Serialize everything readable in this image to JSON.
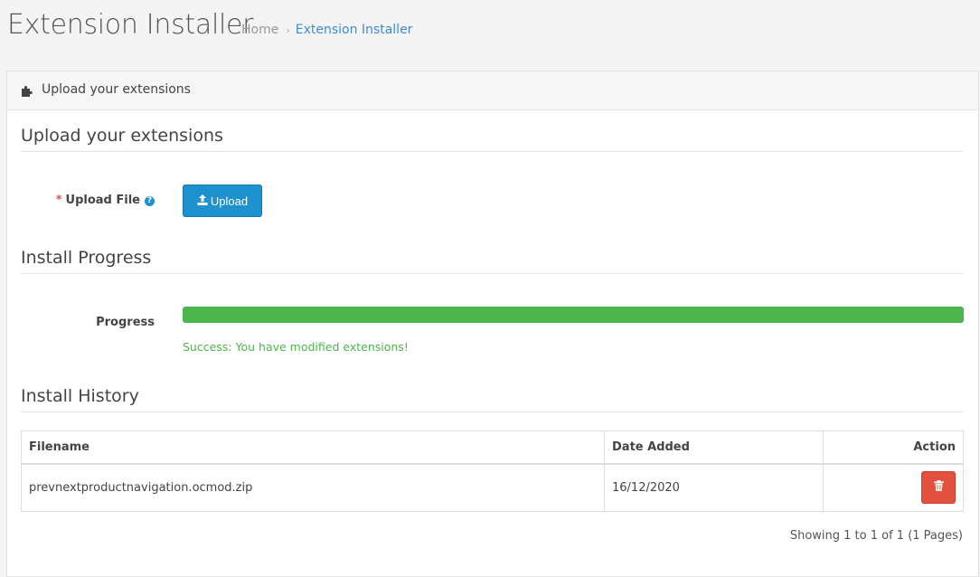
{
  "header": {
    "title": "Extension Installer",
    "breadcrumb": [
      {
        "label": "Home"
      },
      {
        "label": "Extension Installer"
      }
    ],
    "breadcrumb_separator": "›"
  },
  "panel": {
    "heading": "Upload your extensions",
    "heading_icon": "puzzle-icon"
  },
  "upload_section": {
    "legend": "Upload your extensions",
    "required_mark": "*",
    "label": "Upload File",
    "help_icon_glyph": "?",
    "button_label": "Upload",
    "button_icon": "upload-icon"
  },
  "progress_section": {
    "legend": "Install Progress",
    "label": "Progress",
    "value_percent": 100,
    "message": "Success: You have modified extensions!"
  },
  "history_section": {
    "legend": "Install History",
    "columns": {
      "filename": "Filename",
      "date_added": "Date Added",
      "action": "Action"
    },
    "rows": [
      {
        "filename": "prevnextproductnavigation.ocmod.zip",
        "date_added": "16/12/2020",
        "action_icon": "trash-icon"
      }
    ],
    "pagination_text": "Showing 1 to 1 of 1 (1 Pages)"
  },
  "colors": {
    "primary": "#1e91cf",
    "success": "#4cb64c",
    "danger": "#e3503e",
    "link": "#3f8bcf"
  }
}
